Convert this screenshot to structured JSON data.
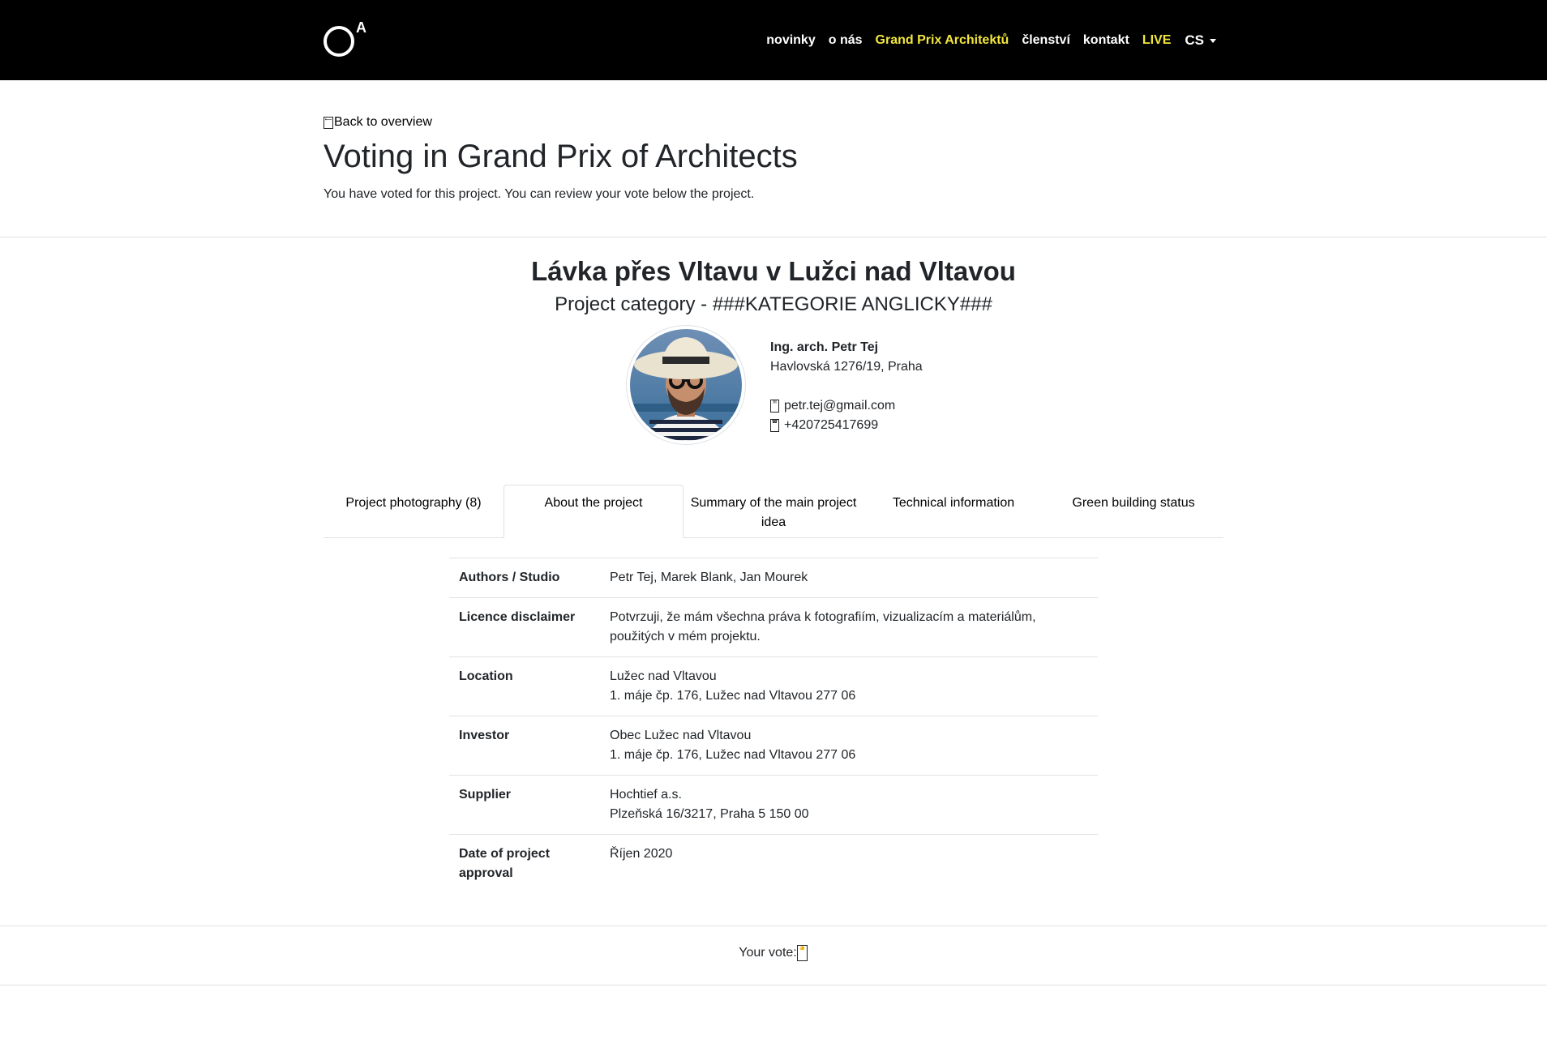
{
  "nav": {
    "logo_letter": "A",
    "items": [
      {
        "label": "novinky",
        "highlight": false
      },
      {
        "label": "o nás",
        "highlight": false
      },
      {
        "label": "Grand Prix Architektů",
        "highlight": true
      },
      {
        "label": "členství",
        "highlight": false
      },
      {
        "label": "kontakt",
        "highlight": false
      },
      {
        "label": "LIVE",
        "highlight": true
      }
    ],
    "language": "CS",
    "highlight_color": "#f2e63d"
  },
  "header": {
    "back_label": "Back to overview",
    "back_icon": "arrow-left-icon",
    "title": "Voting in Grand Prix of Architects",
    "note": "You have voted for this project. You can review your vote below the project."
  },
  "project": {
    "title": "Lávka přes Vltavu v Lužci nad Vltavou",
    "category": "Project category - ###KATEGORIE ANGLICKY###"
  },
  "author": {
    "name": "Ing. arch. Petr Tej",
    "address": "Havlovská 1276/19, Praha",
    "email": "petr.tej@gmail.com",
    "phone": "+420725417699",
    "email_icon": "envelope-icon",
    "phone_icon": "phone-icon"
  },
  "tabs": [
    {
      "label": "Project photography (8)",
      "active": false
    },
    {
      "label": "About the project",
      "active": true
    },
    {
      "label": "Summary of the main project idea",
      "active": false
    },
    {
      "label": "Technical information",
      "active": false
    },
    {
      "label": "Green building status",
      "active": false
    }
  ],
  "details": [
    {
      "label": "Authors / Studio",
      "lines": [
        "Petr Tej, Marek Blank, Jan Mourek"
      ]
    },
    {
      "label": "Licence disclaimer",
      "lines": [
        "Potvrzuji, že mám všechna práva k fotografiím, vizualizacím a materiálům, použitých v mém projektu."
      ]
    },
    {
      "label": "Location",
      "lines": [
        "Lužec nad Vltavou",
        "1. máje čp. 176, Lužec nad Vltavou 277 06"
      ]
    },
    {
      "label": "Investor",
      "lines": [
        "Obec Lužec nad Vltavou",
        "1. máje čp. 176, Lužec nad Vltavou 277 06"
      ]
    },
    {
      "label": "Supplier",
      "lines": [
        "Hochtief a.s.",
        "Plzeňská 16/3217, Praha 5 150 00"
      ]
    },
    {
      "label": "Date of project approval",
      "lines": [
        "Říjen 2020"
      ]
    }
  ],
  "vote": {
    "label": "Your vote:",
    "icon": "thumbs-up-icon"
  }
}
